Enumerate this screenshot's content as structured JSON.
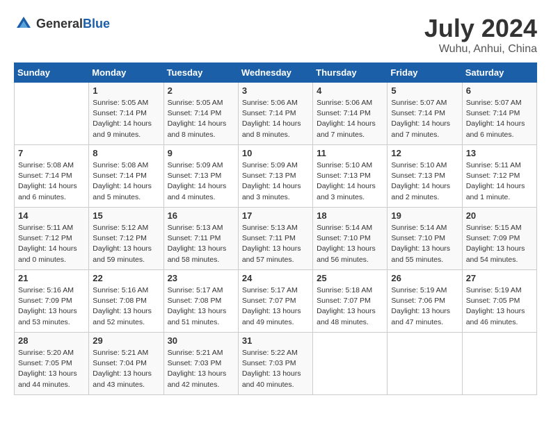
{
  "header": {
    "logo_general": "General",
    "logo_blue": "Blue",
    "month_title": "July 2024",
    "location": "Wuhu, Anhui, China"
  },
  "days_of_week": [
    "Sunday",
    "Monday",
    "Tuesday",
    "Wednesday",
    "Thursday",
    "Friday",
    "Saturday"
  ],
  "weeks": [
    [
      {
        "day": "",
        "info": ""
      },
      {
        "day": "1",
        "info": "Sunrise: 5:05 AM\nSunset: 7:14 PM\nDaylight: 14 hours\nand 9 minutes."
      },
      {
        "day": "2",
        "info": "Sunrise: 5:05 AM\nSunset: 7:14 PM\nDaylight: 14 hours\nand 8 minutes."
      },
      {
        "day": "3",
        "info": "Sunrise: 5:06 AM\nSunset: 7:14 PM\nDaylight: 14 hours\nand 8 minutes."
      },
      {
        "day": "4",
        "info": "Sunrise: 5:06 AM\nSunset: 7:14 PM\nDaylight: 14 hours\nand 7 minutes."
      },
      {
        "day": "5",
        "info": "Sunrise: 5:07 AM\nSunset: 7:14 PM\nDaylight: 14 hours\nand 7 minutes."
      },
      {
        "day": "6",
        "info": "Sunrise: 5:07 AM\nSunset: 7:14 PM\nDaylight: 14 hours\nand 6 minutes."
      }
    ],
    [
      {
        "day": "7",
        "info": "Sunrise: 5:08 AM\nSunset: 7:14 PM\nDaylight: 14 hours\nand 6 minutes."
      },
      {
        "day": "8",
        "info": "Sunrise: 5:08 AM\nSunset: 7:14 PM\nDaylight: 14 hours\nand 5 minutes."
      },
      {
        "day": "9",
        "info": "Sunrise: 5:09 AM\nSunset: 7:13 PM\nDaylight: 14 hours\nand 4 minutes."
      },
      {
        "day": "10",
        "info": "Sunrise: 5:09 AM\nSunset: 7:13 PM\nDaylight: 14 hours\nand 3 minutes."
      },
      {
        "day": "11",
        "info": "Sunrise: 5:10 AM\nSunset: 7:13 PM\nDaylight: 14 hours\nand 3 minutes."
      },
      {
        "day": "12",
        "info": "Sunrise: 5:10 AM\nSunset: 7:13 PM\nDaylight: 14 hours\nand 2 minutes."
      },
      {
        "day": "13",
        "info": "Sunrise: 5:11 AM\nSunset: 7:12 PM\nDaylight: 14 hours\nand 1 minute."
      }
    ],
    [
      {
        "day": "14",
        "info": "Sunrise: 5:11 AM\nSunset: 7:12 PM\nDaylight: 14 hours\nand 0 minutes."
      },
      {
        "day": "15",
        "info": "Sunrise: 5:12 AM\nSunset: 7:12 PM\nDaylight: 13 hours\nand 59 minutes."
      },
      {
        "day": "16",
        "info": "Sunrise: 5:13 AM\nSunset: 7:11 PM\nDaylight: 13 hours\nand 58 minutes."
      },
      {
        "day": "17",
        "info": "Sunrise: 5:13 AM\nSunset: 7:11 PM\nDaylight: 13 hours\nand 57 minutes."
      },
      {
        "day": "18",
        "info": "Sunrise: 5:14 AM\nSunset: 7:10 PM\nDaylight: 13 hours\nand 56 minutes."
      },
      {
        "day": "19",
        "info": "Sunrise: 5:14 AM\nSunset: 7:10 PM\nDaylight: 13 hours\nand 55 minutes."
      },
      {
        "day": "20",
        "info": "Sunrise: 5:15 AM\nSunset: 7:09 PM\nDaylight: 13 hours\nand 54 minutes."
      }
    ],
    [
      {
        "day": "21",
        "info": "Sunrise: 5:16 AM\nSunset: 7:09 PM\nDaylight: 13 hours\nand 53 minutes."
      },
      {
        "day": "22",
        "info": "Sunrise: 5:16 AM\nSunset: 7:08 PM\nDaylight: 13 hours\nand 52 minutes."
      },
      {
        "day": "23",
        "info": "Sunrise: 5:17 AM\nSunset: 7:08 PM\nDaylight: 13 hours\nand 51 minutes."
      },
      {
        "day": "24",
        "info": "Sunrise: 5:17 AM\nSunset: 7:07 PM\nDaylight: 13 hours\nand 49 minutes."
      },
      {
        "day": "25",
        "info": "Sunrise: 5:18 AM\nSunset: 7:07 PM\nDaylight: 13 hours\nand 48 minutes."
      },
      {
        "day": "26",
        "info": "Sunrise: 5:19 AM\nSunset: 7:06 PM\nDaylight: 13 hours\nand 47 minutes."
      },
      {
        "day": "27",
        "info": "Sunrise: 5:19 AM\nSunset: 7:05 PM\nDaylight: 13 hours\nand 46 minutes."
      }
    ],
    [
      {
        "day": "28",
        "info": "Sunrise: 5:20 AM\nSunset: 7:05 PM\nDaylight: 13 hours\nand 44 minutes."
      },
      {
        "day": "29",
        "info": "Sunrise: 5:21 AM\nSunset: 7:04 PM\nDaylight: 13 hours\nand 43 minutes."
      },
      {
        "day": "30",
        "info": "Sunrise: 5:21 AM\nSunset: 7:03 PM\nDaylight: 13 hours\nand 42 minutes."
      },
      {
        "day": "31",
        "info": "Sunrise: 5:22 AM\nSunset: 7:03 PM\nDaylight: 13 hours\nand 40 minutes."
      },
      {
        "day": "",
        "info": ""
      },
      {
        "day": "",
        "info": ""
      },
      {
        "day": "",
        "info": ""
      }
    ]
  ]
}
